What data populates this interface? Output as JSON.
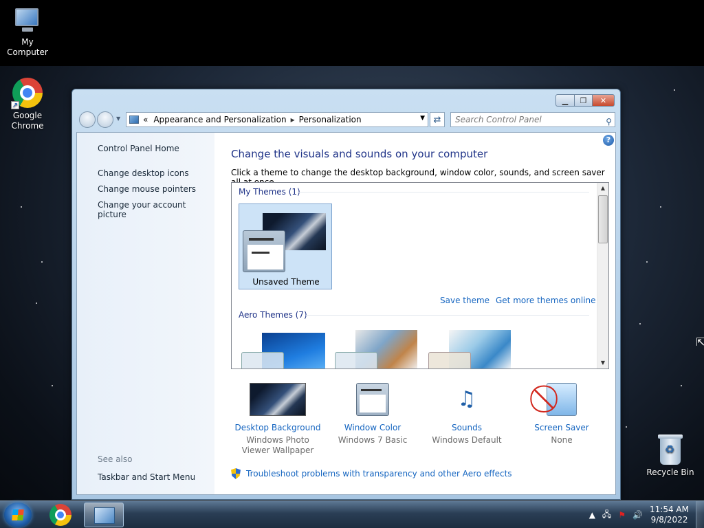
{
  "desktop": {
    "icons": [
      {
        "label": "My Computer"
      },
      {
        "label": "Google Chrome"
      },
      {
        "label": "Recycle Bin"
      }
    ]
  },
  "window": {
    "breadcrumb": {
      "prefix": "«",
      "items": [
        "Appearance and Personalization",
        "Personalization"
      ],
      "separator": "▸"
    },
    "search": {
      "placeholder": "Search Control Panel"
    },
    "left_pane": {
      "links": [
        "Control Panel Home",
        "Change desktop icons",
        "Change mouse pointers",
        "Change your account picture"
      ],
      "see_also_label": "See also",
      "see_also_links": [
        "Taskbar and Start Menu"
      ]
    },
    "main": {
      "title": "Change the visuals and sounds on your computer",
      "subtitle": "Click a theme to change the desktop background, window color, sounds, and screen saver all at once.",
      "groups": {
        "my_themes": "My Themes (1)",
        "aero_themes": "Aero Themes (7)"
      },
      "selected_theme": "Unsaved Theme",
      "save_theme": "Save theme",
      "get_more": "Get more themes online",
      "settings": [
        {
          "name": "Desktop Background",
          "value": "Windows Photo Viewer Wallpaper"
        },
        {
          "name": "Window Color",
          "value": "Windows 7 Basic"
        },
        {
          "name": "Sounds",
          "value": "Windows Default"
        },
        {
          "name": "Screen Saver",
          "value": "None"
        }
      ],
      "troubleshoot": "Troubleshoot problems with transparency and other Aero effects"
    }
  },
  "taskbar": {
    "clock": {
      "time": "11:54 AM",
      "date": "9/8/2022"
    }
  },
  "colors": {
    "link": "#1565c0",
    "heading": "#1e3287"
  }
}
